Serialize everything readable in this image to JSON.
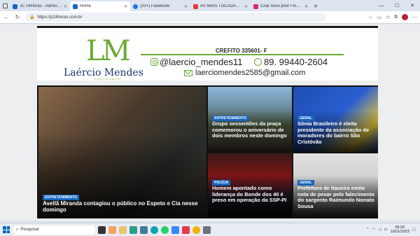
{
  "browser": {
    "tabs": [
      {
        "title": "JC 24Horas - Administração",
        "favicon": "#1565c0",
        "active": false
      },
      {
        "title": "Home",
        "favicon": "#1565c0",
        "active": true
      },
      {
        "title": "(20+) Facebook",
        "favicon": "#1877f2",
        "active": false
      },
      {
        "title": "AS MAIS TOCADAS DO REI \"S",
        "favicon": "#e53935",
        "active": false
      },
      {
        "title": "Criar novo post • Instagram",
        "favicon": "#d62976",
        "active": false
      }
    ],
    "url": "https://jc24horas.com.br"
  },
  "header": {
    "logo_initials_l": "L",
    "logo_initials_m": "M",
    "logo_name": "Laércio Mendes",
    "logo_sub": "Entertainment",
    "credito": "CREFITO 335601- F",
    "instagram": "@laercio_mendes11",
    "whatsapp": "89. 99440-2604",
    "email": "laerciomendes2585@gmail.com"
  },
  "news": [
    {
      "category": "ENTRETENIMENTO",
      "headline": "Avellã Miranda contagiou o público no Espeto e Cia nesse domingo"
    },
    {
      "category": "ENTRETENIMENTO",
      "headline": "Grupo sessentões da praça comemorou o aniversário de dois membros neste domingo"
    },
    {
      "category": "GERAL",
      "headline": "Sônia Brasileiro é eleita presidente da associação de moradores do bairro São Cristóvão"
    },
    {
      "category": "POLÍCIA",
      "headline": "Homem apontado como liderança do Bonde dos 40 é preso em operação da SSP-PI"
    },
    {
      "category": "GERAL",
      "headline": "Prefeitura de Itaueira emite nota de pesar pelo falecimento do sargento Raimundo Nonato Sousa"
    }
  ],
  "taskbar": {
    "search_placeholder": "Pesquisar",
    "time": "05:20",
    "date": "10/11/2023"
  }
}
